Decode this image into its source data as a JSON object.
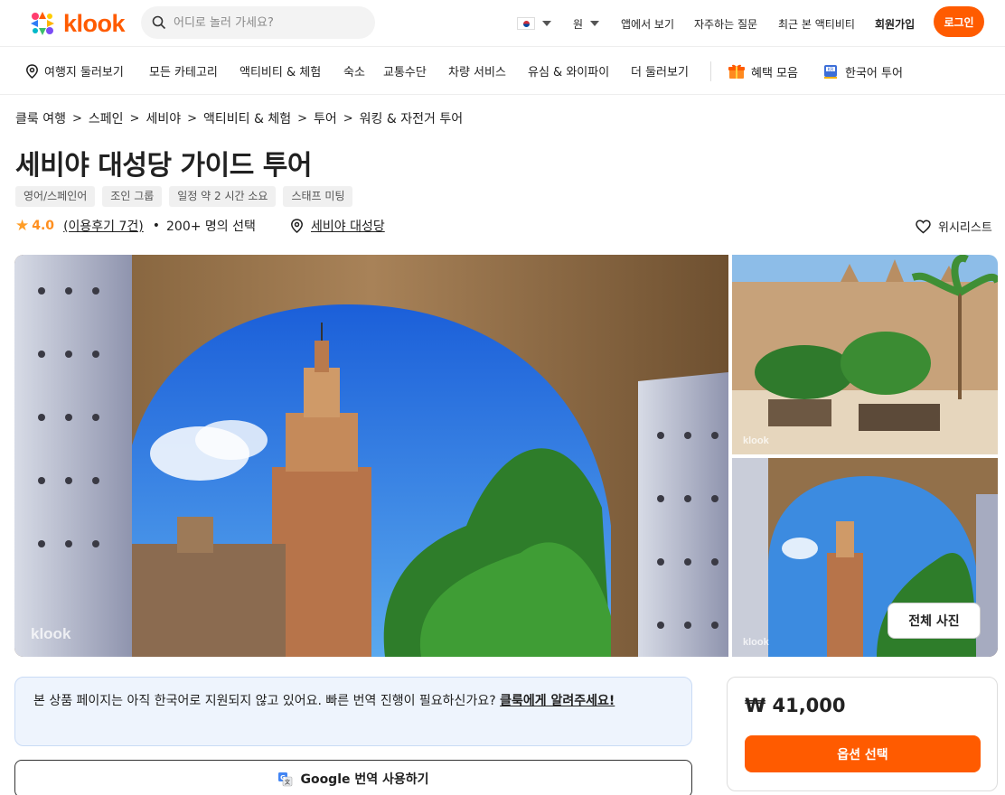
{
  "header": {
    "logo_text": "klook",
    "search_placeholder": "어디로 놀러 가세요?",
    "currency": "원",
    "app_link": "앱에서 보기",
    "faq_link": "자주하는 질문",
    "recent_link": "최근 본 액티비티",
    "signup": "회원가입",
    "login": "로그인"
  },
  "categories": {
    "destinations": "여행지 둘러보기",
    "all": "모든 카테고리",
    "activities": "액티비티 & 체험",
    "stay": "숙소",
    "transport": "교통수단",
    "car": "차량 서비스",
    "sim": "유심 & 와이파이",
    "more": "더 둘러보기",
    "deals": "혜택 모음",
    "korean_tours": "한국어 투어"
  },
  "breadcrumb": [
    "클룩 여행",
    "스페인",
    "세비야",
    "액티비티 & 체험",
    "투어",
    "워킹 & 자전거 투어"
  ],
  "product": {
    "title": "세비야 대성당 가이드 투어",
    "tags": [
      "영어/스페인어",
      "조인 그룹",
      "일정 약 2 시간 소요",
      "스태프 미팅"
    ],
    "rating": "4.0",
    "reviews": "(이용후기 7건)",
    "bookings": "200+ 명의 선택",
    "location": "세비야 대성당",
    "wishlist": "위시리스트"
  },
  "gallery": {
    "watermark": "klook",
    "all_photos": "전체 사진"
  },
  "notice": {
    "text": "본 상품 페이지는 아직 한국어로 지원되지 않고 있어요. 빠른 번역 진행이 필요하신가요? ",
    "link": "클룩에게 알려주세요!"
  },
  "translate_button": "Google 번역 사용하기",
  "pricing": {
    "price": "₩ 41,000",
    "select_button": "옵션 선택"
  },
  "colors": {
    "brand": "#ff5b00",
    "star": "#ff9d26",
    "notice_bg": "#eef4fd"
  }
}
